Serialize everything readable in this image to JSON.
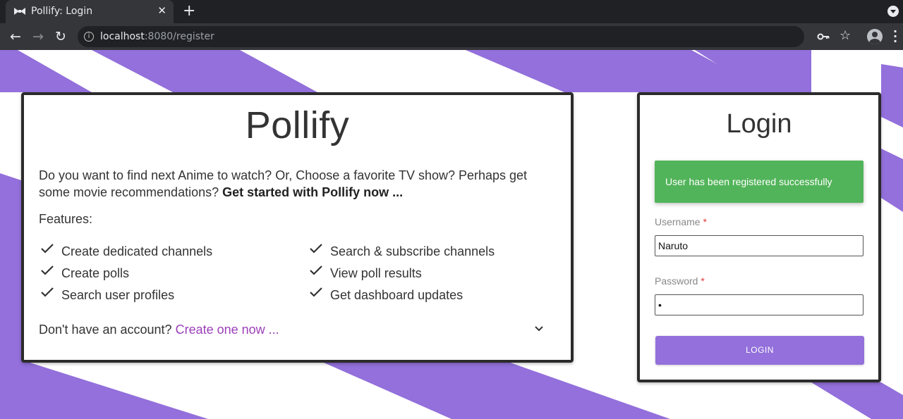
{
  "browser": {
    "tab_title": "Pollify: Login",
    "tab_close_glyph": "✕",
    "new_tab_glyph": "+",
    "url_host": "localhost",
    "url_rest": ":8080/register",
    "icons": [
      "back-icon",
      "forward-icon",
      "reload-icon",
      "site-info-icon",
      "key-icon",
      "star-icon",
      "profile-avatar-icon",
      "menu-icon"
    ]
  },
  "theme": {
    "stripe_color": "#9370db",
    "chrome_dark": "#202124",
    "success_color": "#52b45a",
    "link_color": "#9b3fb8"
  },
  "info_card": {
    "title": "Pollify",
    "description": "Do you want to find next Anime to watch? Or, Choose a favorite TV show? Perhaps get some movie recommendations?",
    "description_cta": "Get started with Pollify now ...",
    "features_label": "Features:",
    "features": [
      "Create dedicated channels",
      "Create polls",
      "Search user profiles",
      "Search & subscribe channels",
      "View poll results",
      "Get dashboard updates"
    ],
    "signup_prompt": "Don't have an account?",
    "signup_link": "Create one now ..."
  },
  "login_card": {
    "title": "Login",
    "alert_message": "User has been registered successfully",
    "username_label": "Username",
    "username_value": "Naruto",
    "password_label": "Password",
    "password_value": "•",
    "required_marker": "*",
    "login_button": "LOGIN"
  }
}
